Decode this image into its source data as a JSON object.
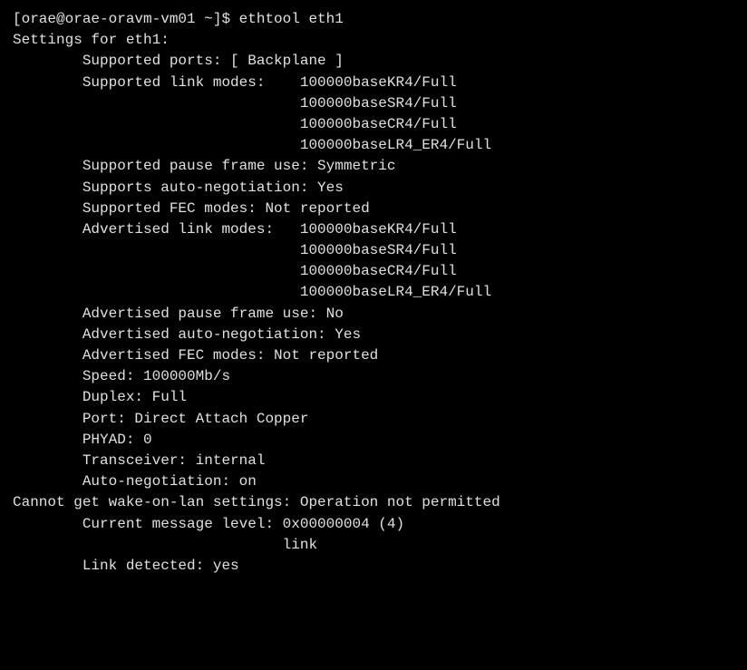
{
  "terminal": {
    "prompt_line": "[orae@orae-oravm-vm01 ~]$ ethtool eth1",
    "lines": [
      {
        "text": "Settings for eth1:",
        "indent": 0
      },
      {
        "text": "        Supported ports: [ Backplane ]",
        "indent": 0
      },
      {
        "text": "        Supported link modes:    100000baseKR4/Full",
        "indent": 0
      },
      {
        "text": "                                 100000baseSR4/Full",
        "indent": 0
      },
      {
        "text": "                                 100000baseCR4/Full",
        "indent": 0
      },
      {
        "text": "                                 100000baseLR4_ER4/Full",
        "indent": 0
      },
      {
        "text": "        Supported pause frame use: Symmetric",
        "indent": 0
      },
      {
        "text": "        Supports auto-negotiation: Yes",
        "indent": 0
      },
      {
        "text": "        Supported FEC modes: Not reported",
        "indent": 0
      },
      {
        "text": "        Advertised link modes:   100000baseKR4/Full",
        "indent": 0
      },
      {
        "text": "                                 100000baseSR4/Full",
        "indent": 0
      },
      {
        "text": "                                 100000baseCR4/Full",
        "indent": 0
      },
      {
        "text": "                                 100000baseLR4_ER4/Full",
        "indent": 0
      },
      {
        "text": "        Advertised pause frame use: No",
        "indent": 0
      },
      {
        "text": "        Advertised auto-negotiation: Yes",
        "indent": 0
      },
      {
        "text": "        Advertised FEC modes: Not reported",
        "indent": 0
      },
      {
        "text": "        Speed: 100000Mb/s",
        "indent": 0
      },
      {
        "text": "        Duplex: Full",
        "indent": 0
      },
      {
        "text": "        Port: Direct Attach Copper",
        "indent": 0
      },
      {
        "text": "        PHYAD: 0",
        "indent": 0
      },
      {
        "text": "        Transceiver: internal",
        "indent": 0
      },
      {
        "text": "        Auto-negotiation: on",
        "indent": 0
      },
      {
        "text": "Cannot get wake-on-lan settings: Operation not permitted",
        "indent": 0
      },
      {
        "text": "        Current message level: 0x00000004 (4)",
        "indent": 0
      },
      {
        "text": "                               link",
        "indent": 0
      },
      {
        "text": "        Link detected: yes",
        "indent": 0
      }
    ]
  }
}
